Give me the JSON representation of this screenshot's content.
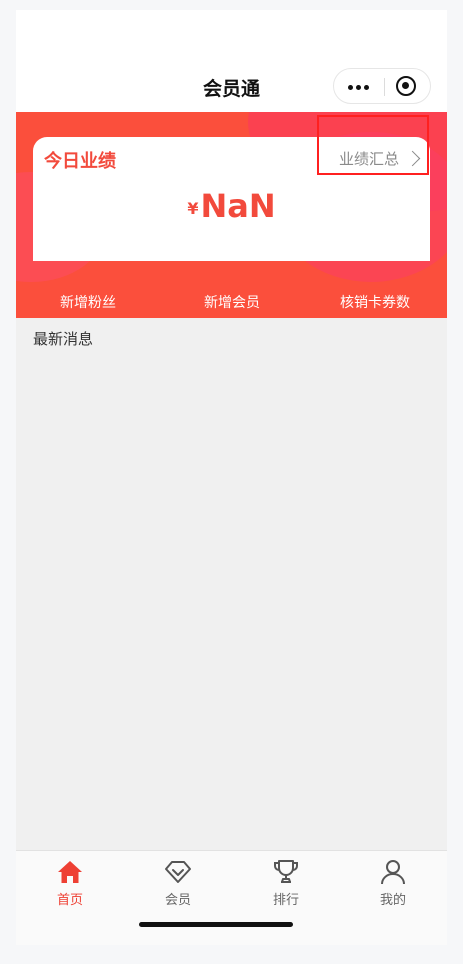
{
  "navbar": {
    "title": "会员通"
  },
  "card": {
    "title": "今日业绩",
    "link_label": "业绩汇总",
    "currency": "¥",
    "amount": "NaN"
  },
  "stats": [
    {
      "label": "新增粉丝"
    },
    {
      "label": "新增会员"
    },
    {
      "label": "核销卡券数"
    }
  ],
  "section": {
    "title": "最新消息"
  },
  "tabbar": {
    "items": [
      {
        "label": "首页",
        "icon": "home-icon",
        "active": true
      },
      {
        "label": "会员",
        "icon": "diamond-icon",
        "active": false
      },
      {
        "label": "排行",
        "icon": "trophy-icon",
        "active": false
      },
      {
        "label": "我的",
        "icon": "person-icon",
        "active": false
      }
    ]
  },
  "colors": {
    "accent": "#f24a3c",
    "banner": "#fb4f3c",
    "highlight": "#ff2020"
  }
}
